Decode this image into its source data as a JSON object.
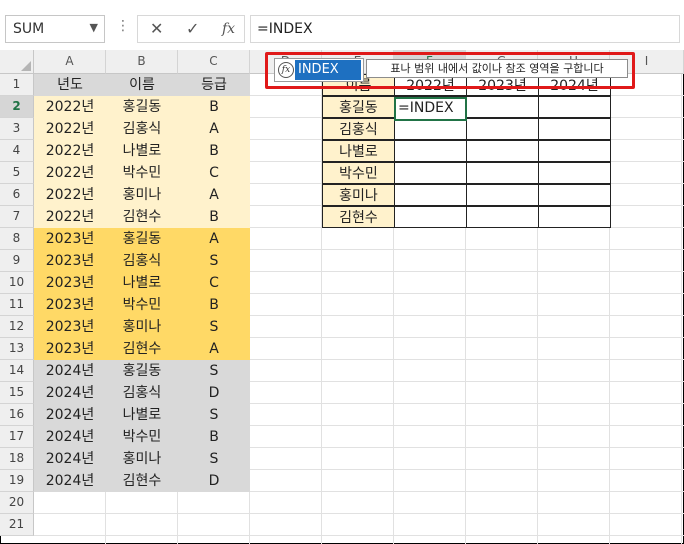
{
  "namebox": {
    "value": "SUM",
    "arrow": "▼"
  },
  "formula_bar": {
    "options_icon": "⋮",
    "cancel_icon": "✕",
    "enter_icon": "✓",
    "fx_label": "fx",
    "formula": "=INDEX"
  },
  "columns": [
    "A",
    "B",
    "C",
    "D",
    "E",
    "F",
    "G",
    "H",
    "I"
  ],
  "rows": [
    "1",
    "2",
    "3",
    "4",
    "5",
    "6",
    "7",
    "8",
    "9",
    "10",
    "11",
    "12",
    "13",
    "14",
    "15",
    "16",
    "17",
    "18",
    "19",
    "20",
    "21"
  ],
  "left_table": {
    "headers": [
      "년도",
      "이름",
      "등급"
    ],
    "rows": [
      [
        "2022년",
        "홍길동",
        "B"
      ],
      [
        "2022년",
        "김홍식",
        "A"
      ],
      [
        "2022년",
        "나별로",
        "B"
      ],
      [
        "2022년",
        "박수민",
        "C"
      ],
      [
        "2022년",
        "홍미나",
        "A"
      ],
      [
        "2022년",
        "김현수",
        "B"
      ],
      [
        "2023년",
        "홍길동",
        "A"
      ],
      [
        "2023년",
        "김홍식",
        "S"
      ],
      [
        "2023년",
        "나별로",
        "C"
      ],
      [
        "2023년",
        "박수민",
        "B"
      ],
      [
        "2023년",
        "홍미나",
        "S"
      ],
      [
        "2023년",
        "김현수",
        "A"
      ],
      [
        "2024년",
        "홍길동",
        "S"
      ],
      [
        "2024년",
        "김홍식",
        "D"
      ],
      [
        "2024년",
        "나별로",
        "S"
      ],
      [
        "2024년",
        "박수민",
        "B"
      ],
      [
        "2024년",
        "홍미나",
        "S"
      ],
      [
        "2024년",
        "김현수",
        "D"
      ]
    ],
    "colors": {
      "header": "#d9d9d9",
      "y2022": "#fff2cc",
      "y2023": "#ffd966",
      "y2024": "#d9d9d9"
    }
  },
  "right_table": {
    "headers": [
      "이름",
      "2022년",
      "2023년",
      "2024년"
    ],
    "names": [
      "홍길동",
      "김홍식",
      "나별로",
      "박수민",
      "홍미나",
      "김현수"
    ],
    "active_cell_value": "=INDEX",
    "name_fill": "#fff2cc"
  },
  "autocomplete": {
    "icon": "fx",
    "function_name": "INDEX",
    "tooltip": "표나 범위 내에서 값이나 참조 영역을 구합니다"
  },
  "colors": {
    "accent": "#217346",
    "highlight": "#e01919",
    "selection": "#1e70c1"
  }
}
